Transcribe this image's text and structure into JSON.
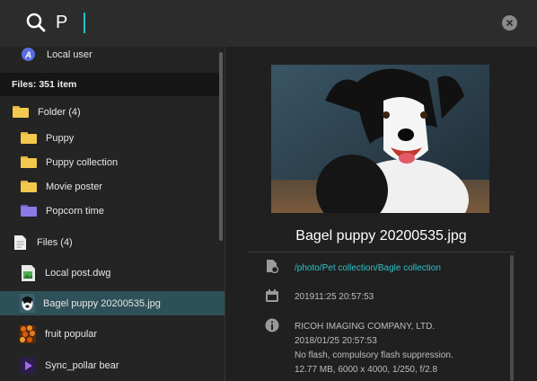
{
  "search": {
    "query": "P"
  },
  "left": {
    "local_user": "Local user",
    "files_header": "Files: 351 item",
    "folder_group": "Folder (4)",
    "folders": [
      "Puppy",
      "Puppy collection",
      "Movie poster",
      "Popcorn time"
    ],
    "files_group": "Files (4)",
    "files": [
      "Local post.dwg",
      "Bagel puppy 20200535.jpg",
      "fruit popular",
      "Sync_pollar bear"
    ]
  },
  "preview": {
    "filename": "Bagel puppy 20200535.jpg",
    "path": "/photo/Pet collection/Bagle collection",
    "modified": "201911:25 20:57:53",
    "camera": "RICOH IMAGING COMPANY,  LTD.",
    "taken": "2018/01/25 20:57:53",
    "flash": "No flash, compulsory flash suppression.",
    "specs": "12.77 MB, 6000 x 4000, 1/250, f/2.8"
  },
  "colors": {
    "accent": "#19c6c8",
    "selected_row": "#2e5058",
    "folder_yellow": "#f2c94c",
    "folder_purple": "#8a7ae6"
  }
}
